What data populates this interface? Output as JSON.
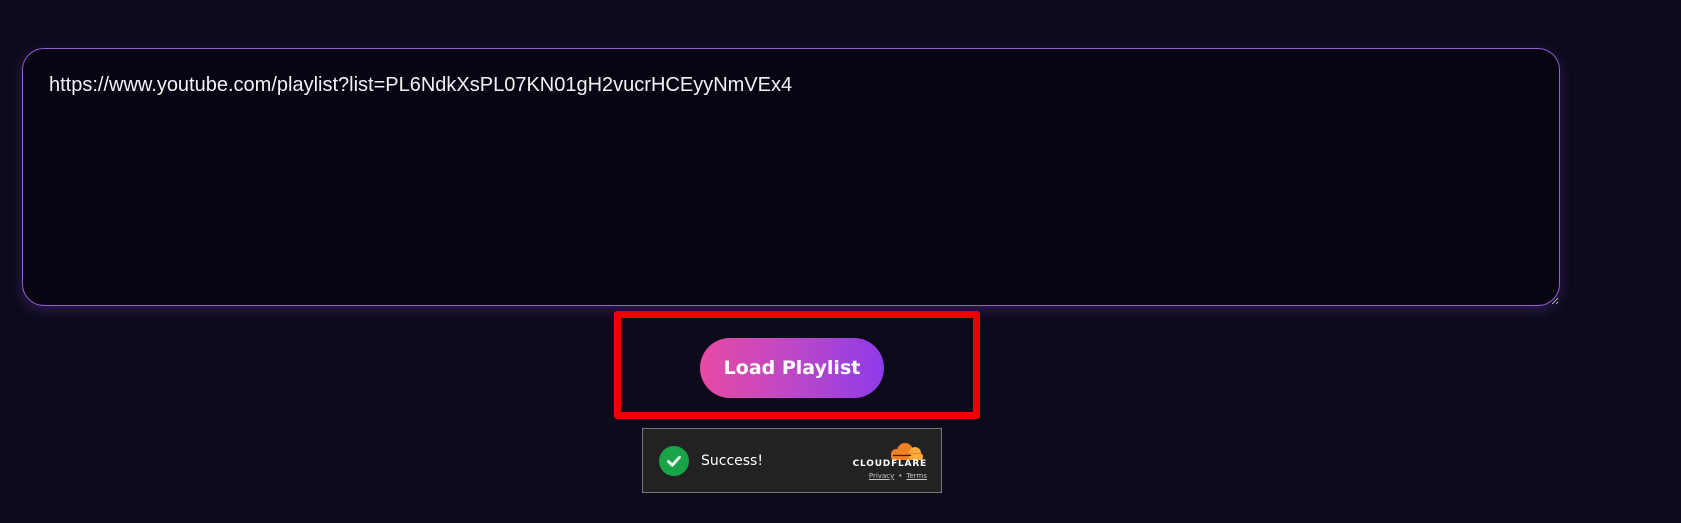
{
  "playlist_input": {
    "value": "https://www.youtube.com/playlist?list=PL6NdkXsPL07KN01gH2vucrHCEyyNmVEx4"
  },
  "load_button": {
    "label": "Load Playlist"
  },
  "captcha": {
    "status_text": "Success!",
    "provider": "CLOUDFLARE",
    "privacy_label": "Privacy",
    "separator": "•",
    "terms_label": "Terms",
    "status_icon": "check-icon",
    "status_color": "#1aa448",
    "cloud_color": "#f38020"
  },
  "colors": {
    "background": "#0d0a1c",
    "input_border": "#8f5fd6",
    "button_gradient_start": "#e84aa2",
    "button_gradient_end": "#8d3bea",
    "highlight": "#ee0000"
  }
}
